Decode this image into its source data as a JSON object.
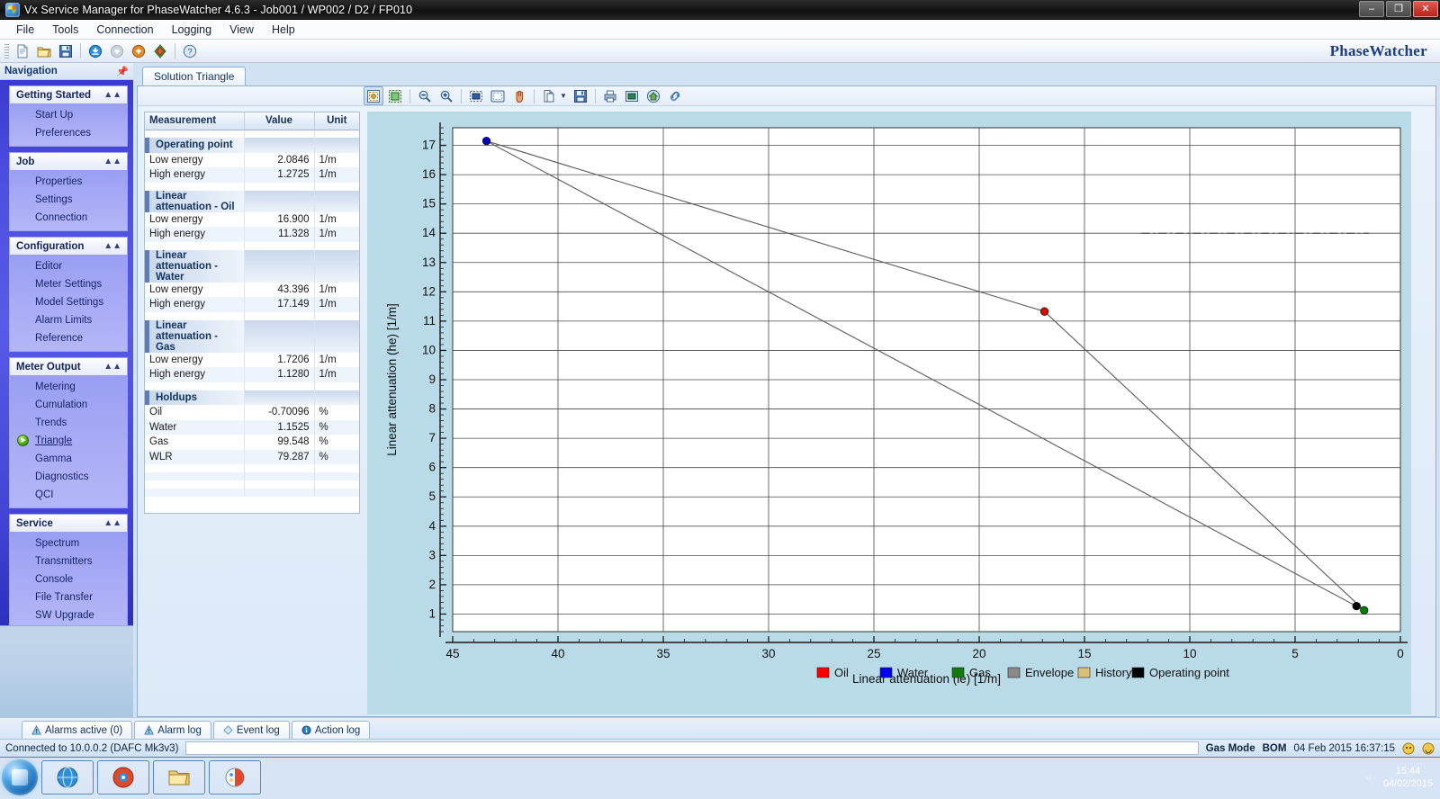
{
  "window": {
    "title": "Vx Service Manager for PhaseWatcher 4.6.3 - Job001 / WP002 / D2 / FP010",
    "minimize_label": "–",
    "maximize_label": "❐",
    "close_label": "✕"
  },
  "menu": [
    "File",
    "Tools",
    "Connection",
    "Logging",
    "View",
    "Help"
  ],
  "toolbar": {
    "buttons": [
      {
        "name": "new-document-icon",
        "glyph": "new"
      },
      {
        "name": "open-folder-icon",
        "glyph": "open"
      },
      {
        "name": "save-icon",
        "glyph": "save"
      },
      {
        "name": "download-icon",
        "glyph": "down"
      },
      {
        "name": "upload-disabled-icon",
        "glyph": "up-gray"
      },
      {
        "name": "upload-icon",
        "glyph": "up"
      },
      {
        "name": "refresh-icon",
        "glyph": "refresh"
      },
      {
        "name": "help-icon",
        "glyph": "help"
      }
    ]
  },
  "brand": {
    "prefix": "Phase",
    "suffix": "Watcher"
  },
  "navigation": {
    "header": "Navigation",
    "pin_icon": "pin-icon",
    "groups": [
      {
        "title": "Getting Started",
        "items": [
          "Start Up",
          "Preferences"
        ]
      },
      {
        "title": "Job",
        "items": [
          "Properties",
          "Settings",
          "Connection"
        ]
      },
      {
        "title": "Configuration",
        "items": [
          "Editor",
          "Meter Settings",
          "Model Settings",
          "Alarm Limits",
          "Reference"
        ]
      },
      {
        "title": "Meter Output",
        "items": [
          "Metering",
          "Cumulation",
          "Trends",
          "Triangle",
          "Gamma",
          "Diagnostics",
          "QCI"
        ],
        "active": "Triangle"
      },
      {
        "title": "Service",
        "items": [
          "Spectrum",
          "Transmitters",
          "Console",
          "File Transfer",
          "SW Upgrade"
        ]
      }
    ]
  },
  "tabs": [
    {
      "label": "Solution Triangle",
      "active": true
    }
  ],
  "chart_toolbar": {
    "buttons": [
      {
        "name": "fit-to-window-button",
        "glyph": "fit",
        "pressed": true
      },
      {
        "name": "select-region-button",
        "glyph": "marquee"
      },
      {
        "name": "zoom-out-button",
        "glyph": "zoom-minus"
      },
      {
        "name": "zoom-in-button",
        "glyph": "zoom-plus"
      },
      {
        "name": "zoom-box-button",
        "glyph": "zoombox"
      },
      {
        "name": "pan-frame-button",
        "glyph": "frame"
      },
      {
        "name": "hand-pan-button",
        "glyph": "hand"
      },
      {
        "name": "copy-button",
        "glyph": "copy"
      },
      {
        "name": "copy-dropdown-button",
        "glyph": "caret"
      },
      {
        "name": "save-image-button",
        "glyph": "save"
      },
      {
        "name": "print-button",
        "glyph": "print"
      },
      {
        "name": "properties-button",
        "glyph": "props"
      },
      {
        "name": "home-view-button",
        "glyph": "home"
      },
      {
        "name": "link-button",
        "glyph": "link"
      }
    ]
  },
  "measurement_table": {
    "headers": [
      "Measurement",
      "Value",
      "Unit"
    ],
    "rows": [
      {
        "type": "blank"
      },
      {
        "type": "group",
        "label": "Operating point"
      },
      {
        "type": "data",
        "label": "Low energy",
        "value": "2.0846",
        "unit": "1/m"
      },
      {
        "type": "data",
        "label": "High energy",
        "value": "1.2725",
        "unit": "1/m"
      },
      {
        "type": "blank"
      },
      {
        "type": "group",
        "label": "Linear attenuation - Oil"
      },
      {
        "type": "data",
        "label": "Low energy",
        "value": "16.900",
        "unit": "1/m"
      },
      {
        "type": "data",
        "label": "High energy",
        "value": "11.328",
        "unit": "1/m"
      },
      {
        "type": "blank"
      },
      {
        "type": "group",
        "label": "Linear attenuation - Water"
      },
      {
        "type": "data",
        "label": "Low energy",
        "value": "43.396",
        "unit": "1/m"
      },
      {
        "type": "data",
        "label": "High energy",
        "value": "17.149",
        "unit": "1/m"
      },
      {
        "type": "blank"
      },
      {
        "type": "group",
        "label": "Linear attenuation - Gas"
      },
      {
        "type": "data",
        "label": "Low energy",
        "value": "1.7206",
        "unit": "1/m"
      },
      {
        "type": "data",
        "label": "High energy",
        "value": "1.1280",
        "unit": "1/m"
      },
      {
        "type": "blank"
      },
      {
        "type": "group",
        "label": "Holdups"
      },
      {
        "type": "data",
        "label": "Oil",
        "value": "-0.70096",
        "unit": "%"
      },
      {
        "type": "data",
        "label": "Water",
        "value": "1.1525",
        "unit": "%"
      },
      {
        "type": "data",
        "label": "Gas",
        "value": "99.548",
        "unit": "%"
      },
      {
        "type": "data",
        "label": "WLR",
        "value": "79.287",
        "unit": "%"
      },
      {
        "type": "blank"
      },
      {
        "type": "blank"
      },
      {
        "type": "blank"
      },
      {
        "type": "blank"
      }
    ]
  },
  "chart_data": {
    "type": "scatter",
    "title": "",
    "xlabel": "Linear attenuation (le) [1/m]",
    "ylabel": "Linear attenuation (he) [1/m]",
    "xlim": [
      45,
      0
    ],
    "ylim": [
      17.6,
      0.4
    ],
    "x_ticks": [
      45,
      40,
      35,
      30,
      25,
      20,
      15,
      10,
      5,
      0
    ],
    "y_ticks": [
      1,
      2,
      3,
      4,
      5,
      6,
      7,
      8,
      9,
      10,
      11,
      12,
      13,
      14,
      15,
      16,
      17
    ],
    "grid": true,
    "x_inverted": true,
    "y_inverted": true,
    "points": [
      {
        "name": "Water",
        "x": 43.396,
        "y": 17.149,
        "color": "#0000cd"
      },
      {
        "name": "Oil",
        "x": 16.9,
        "y": 11.328,
        "color": "#e00000"
      },
      {
        "name": "Gas",
        "x": 1.7206,
        "y": 1.128,
        "color": "#008000"
      },
      {
        "name": "Operating point",
        "x": 2.0846,
        "y": 1.2725,
        "color": "#000000"
      }
    ],
    "envelope": [
      {
        "from": "Water",
        "to": "Oil"
      },
      {
        "from": "Oil",
        "to": "Gas"
      },
      {
        "from": "Water",
        "to": "Gas"
      }
    ],
    "reference_line": {
      "y": 14.0,
      "x_from": 12.3,
      "x_to": 1.5,
      "style": "dash-dot"
    },
    "legend": {
      "position": "bottom",
      "entries": [
        {
          "label": "Oil",
          "color": "#ff0000"
        },
        {
          "label": "Water",
          "color": "#0000ee"
        },
        {
          "label": "Gas",
          "color": "#127a12"
        },
        {
          "label": "Envelope",
          "color": "#8a8a8a"
        },
        {
          "label": "History",
          "color": "#d8c078"
        },
        {
          "label": "Operating point",
          "color": "#000000"
        }
      ]
    }
  },
  "log_tabs": [
    {
      "label": "Alarms active (0)",
      "icon": "alarm-icon"
    },
    {
      "label": "Alarm log",
      "icon": "alarm-icon"
    },
    {
      "label": "Event log",
      "icon": "event-icon"
    },
    {
      "label": "Action log",
      "icon": "info-icon"
    }
  ],
  "status_bar": {
    "connection": "Connected to 10.0.0.2 (DAFC Mk3v3)",
    "gas_mode_label": "Gas Mode",
    "gas_mode_value": "BOM",
    "datetime": "04 Feb 2015 16:37:15"
  },
  "taskbar": {
    "start_label": "start",
    "clock_time": "15:44",
    "clock_date": "04/02/2015",
    "items": [
      "browser-icon",
      "media-icon",
      "folder-icon",
      "paint-icon"
    ]
  }
}
